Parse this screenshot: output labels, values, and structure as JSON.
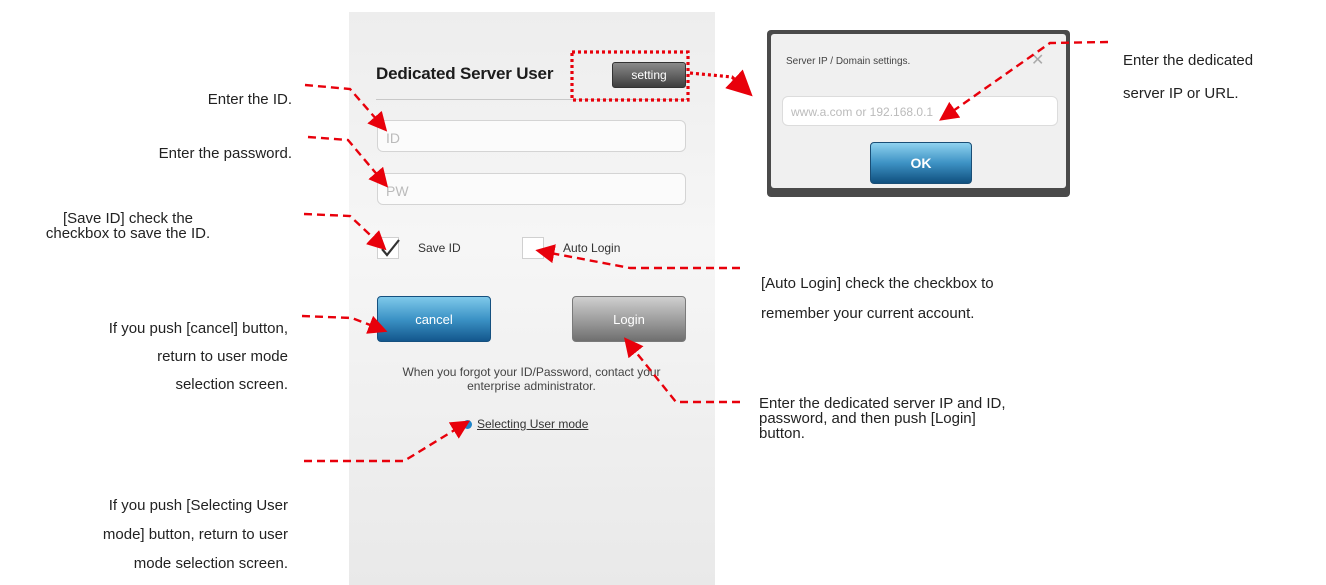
{
  "login_screen": {
    "title": "Dedicated Server User",
    "settings_label": "setting",
    "id_placeholder": "ID",
    "pw_placeholder": "PW",
    "save_id_label": "Save ID",
    "save_id_checked": true,
    "auto_login_label": "Auto Login",
    "auto_login_checked": false,
    "cancel_label": "cancel",
    "login_label": "Login",
    "forgot_line1": "When you forgot your ID/Password, contact your",
    "forgot_line2": "enterprise administrator.",
    "selecting_mode_label": "Selecting User mode"
  },
  "settings_dialog": {
    "title": "Server IP / Domain settings.",
    "close_icon": "close-icon",
    "input_placeholder": "www.a.com or 192.168.0.1",
    "ok_label": "OK"
  },
  "annotations": {
    "enter_id": "Enter the ID.",
    "enter_password": "Enter the password.",
    "save_id_line1": "[Save ID] check the",
    "save_id_line2": "checkbox to save the ID.",
    "cancel_line1": "If you push [cancel] button,",
    "cancel_line2": "return to user mode",
    "cancel_line3": "selection screen.",
    "select_mode_line1": "If you push [Selecting User",
    "select_mode_line2": "mode] button, return to user",
    "select_mode_line3": "mode selection screen.",
    "server_line1": "Enter the dedicated",
    "server_line2": "server IP or URL.",
    "auto_login_line1": "[Auto Login] check the checkbox to",
    "auto_login_line2": "remember your current account.",
    "login_line1": "Enter the dedicated server IP and ID,",
    "login_line2": "password,  and  then  push  [Login]",
    "login_line3": "button."
  },
  "colors": {
    "annotation_red": "#e8000b",
    "cancel_blue": "#3c93c6",
    "login_gray": "#9b9b9b"
  }
}
